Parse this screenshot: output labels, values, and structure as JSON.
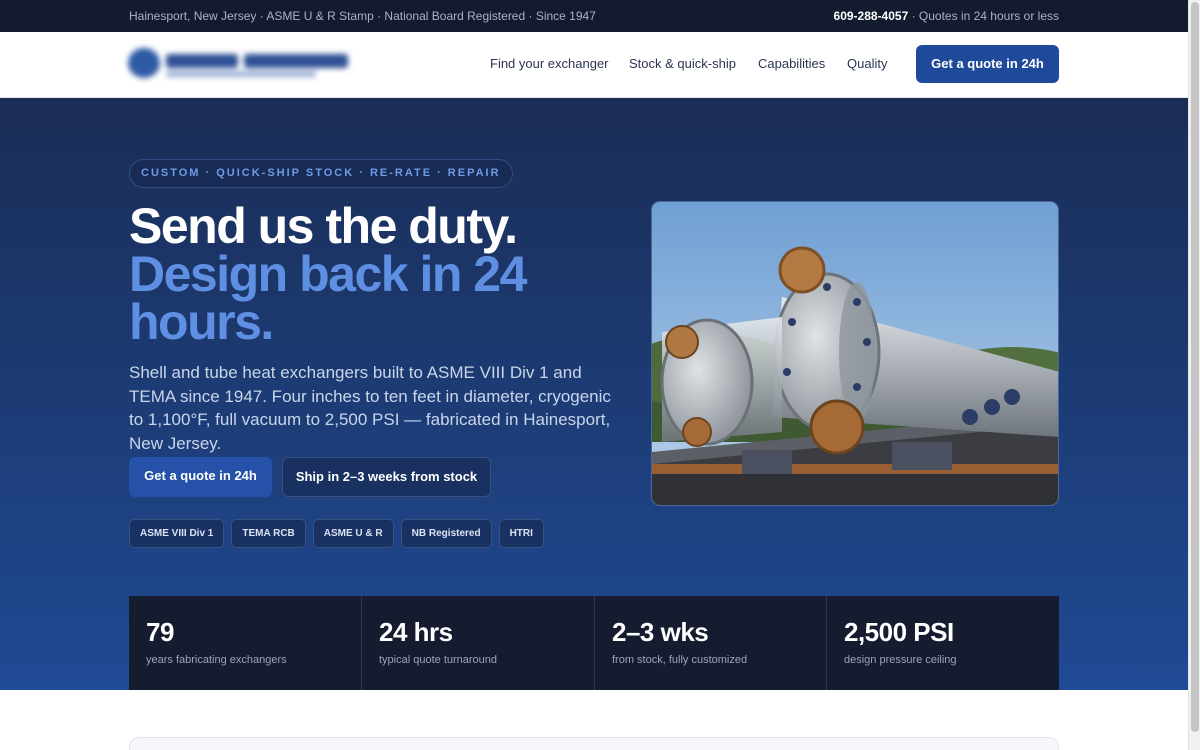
{
  "topbar": {
    "left_text": "Hainesport, New Jersey · ASME U & R Stamp · National Board Registered · Since 1947",
    "phone": "609-288-4057",
    "right_text": " · Quotes in 24 hours or less"
  },
  "header": {
    "nav": [
      "Find your exchanger",
      "Stock & quick-ship",
      "Capabilities",
      "Quality"
    ],
    "cta_label": "Get a quote in 24h"
  },
  "hero": {
    "eyebrow": "CUSTOM · QUICK-SHIP STOCK · RE-RATE · REPAIR",
    "headline_line1": "Send us the duty.",
    "headline_line2": "Design back in 24 hours.",
    "lead": "Shell and tube heat exchangers built to ASME VIII Div 1 and TEMA since 1947. Four inches to ten feet in diameter, cryogenic to 1,100°F, full vacuum to 2,500 PSI — fabricated in Hainesport, New Jersey.",
    "primary_cta": "Get a quote in 24h",
    "secondary_cta": "Ship in 2–3 weeks from stock",
    "badges": [
      "ASME VIII Div 1",
      "TEMA RCB",
      "ASME U & R",
      "NB Registered",
      "HTRI"
    ]
  },
  "stats": [
    {
      "value": "79",
      "label": "years fabricating exchangers"
    },
    {
      "value": "24 hrs",
      "label": "typical quote turnaround"
    },
    {
      "value": "2–3 wks",
      "label": "from stock, fully customized"
    },
    {
      "value": "2,500 PSI",
      "label": "design pressure ceiling"
    }
  ],
  "colors": {
    "brand_blue": "#1f4a9a",
    "accent_blue": "#5f8fe2",
    "dark_navy": "#151c2f",
    "topbar_bg": "#151b2e"
  }
}
